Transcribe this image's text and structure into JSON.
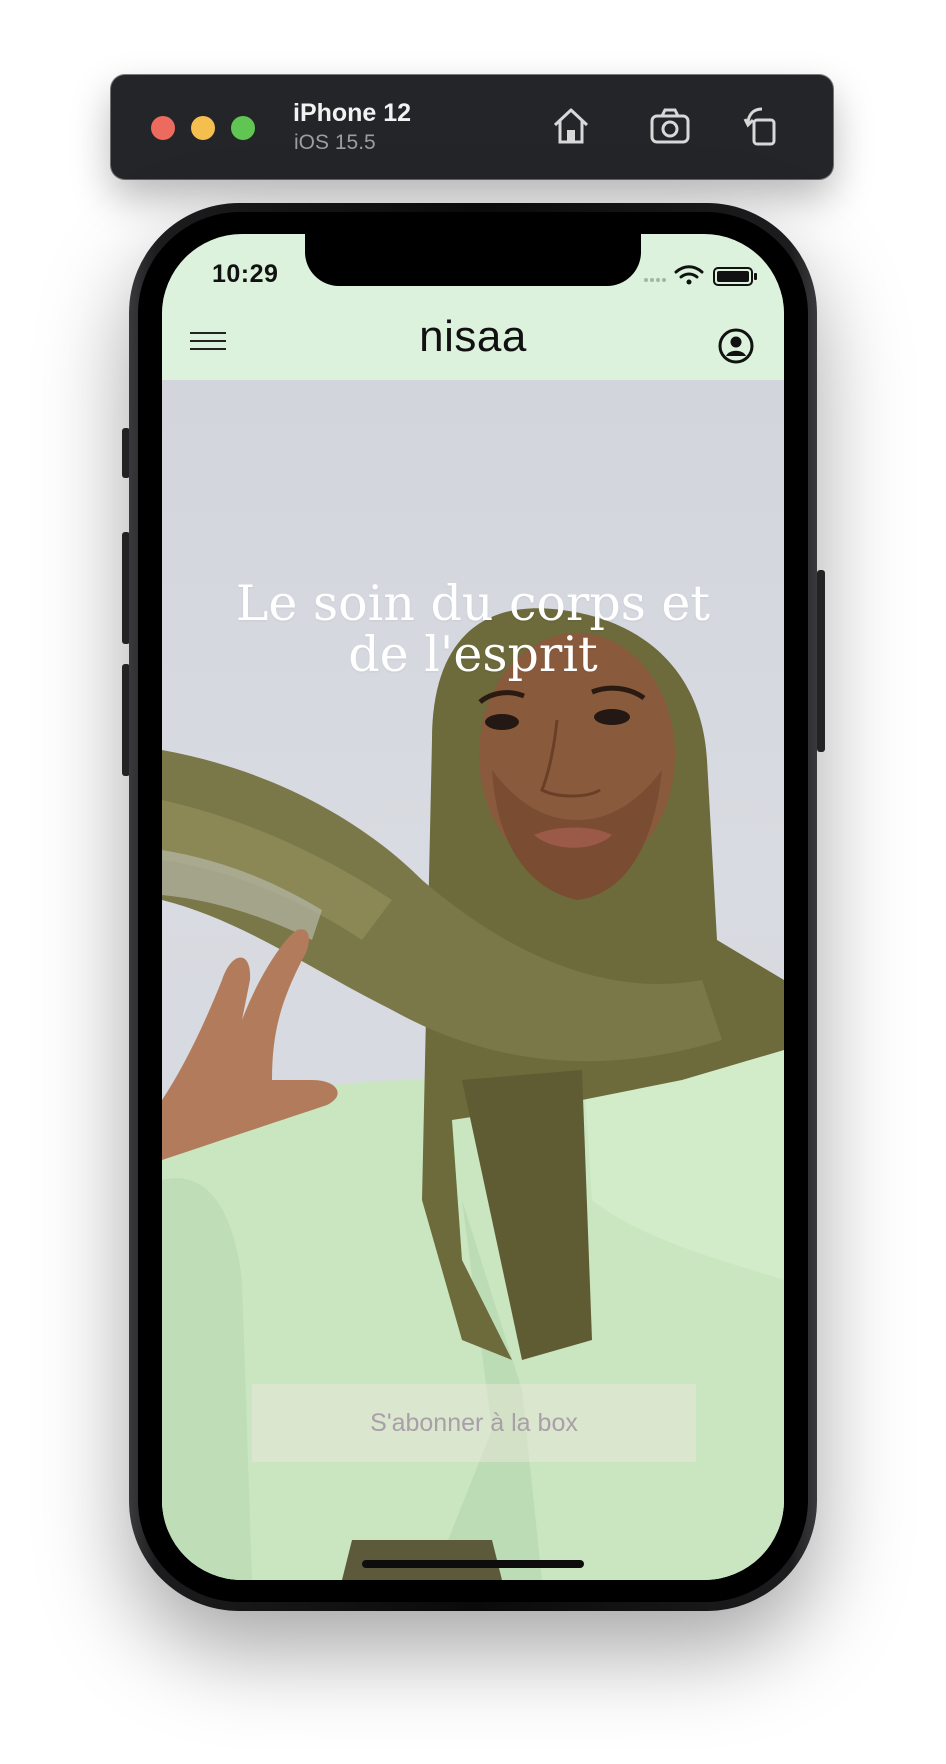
{
  "simulator": {
    "device_name": "iPhone 12",
    "os_version": "iOS 15.5",
    "toolbar_icons": [
      "home-icon",
      "screenshot-icon",
      "rotate-icon"
    ]
  },
  "status_bar": {
    "time": "10:29",
    "icons": [
      "cellular-icon",
      "wifi-icon",
      "battery-icon"
    ]
  },
  "app": {
    "brand": "nisaa",
    "header_bg": "#dcf2dc",
    "menu_icon": "hamburger-menu-icon",
    "account_icon": "account-circle-icon",
    "hero": {
      "title": "Le soin du corps et de l'esprit",
      "image": "woman-in-olive-hijab-and-mint-jacket"
    },
    "cta": {
      "label": "S'abonner à la box"
    }
  }
}
